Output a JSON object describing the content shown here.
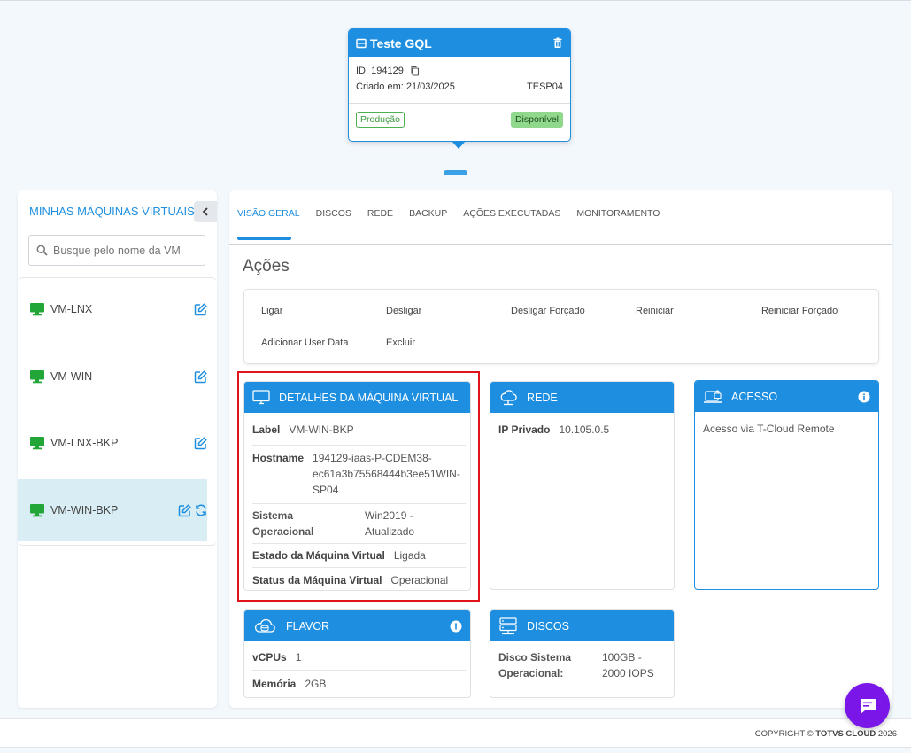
{
  "project": {
    "title": "Teste GQL",
    "id_label": "ID: 194129",
    "created": "Criado em: 21/03/2025",
    "code": "TESP04",
    "env_tag": "Produção",
    "status_tag": "Disponível"
  },
  "sidebar": {
    "title": "MINHAS MÁQUINAS VIRTUAIS",
    "search_placeholder": "Busque pelo nome da VM",
    "vms": [
      {
        "name": "VM-LNX"
      },
      {
        "name": "VM-WIN"
      },
      {
        "name": "VM-LNX-BKP"
      },
      {
        "name": "VM-WIN-BKP",
        "selected": true
      }
    ]
  },
  "tabs": [
    "VISÃO GERAL",
    "DISCOS",
    "REDE",
    "BACKUP",
    "AÇÕES EXECUTADAS",
    "MONITORAMENTO"
  ],
  "actions": {
    "title": "Ações",
    "items": [
      "Ligar",
      "Desligar",
      "Desligar Forçado",
      "Reiniciar",
      "Reiniciar Forçado",
      "Adicionar User Data",
      "Excluir"
    ]
  },
  "details": {
    "title": "DETALHES DA MÁQUINA VIRTUAL",
    "label_k": "Label",
    "label_v": "VM-WIN-BKP",
    "hostname_k": "Hostname",
    "hostname_v1": "194129-iaas-P-CDEM38-",
    "hostname_v2": "ec61a3b75568444b3ee51WIN-",
    "hostname_v3": "SP04",
    "so_k1": "Sistema",
    "so_k2": "Operacional",
    "so_v1": "Win2019 -",
    "so_v2": "Atualizado",
    "estado_k": "Estado da Máquina Virtual",
    "estado_v": "Ligada",
    "status_k": "Status da Máquina Virtual",
    "status_v": "Operacional"
  },
  "rede": {
    "title": "REDE",
    "ip_k": "IP Privado",
    "ip_v": "10.105.0.5"
  },
  "acesso": {
    "title": "ACESSO",
    "text": "Acesso via T-Cloud Remote"
  },
  "flavor": {
    "title": "FLAVOR",
    "vcpu_k": "vCPUs",
    "vcpu_v": "1",
    "mem_k": "Memória",
    "mem_v": "2GB"
  },
  "discos": {
    "title": "DISCOS",
    "k1": "Disco Sistema",
    "k2": "Operacional:",
    "v1": "100GB -",
    "v2": "2000 IOPS"
  },
  "footer": {
    "copy_prefix": "COPYRIGHT ©",
    "copy_brand": "TOTVS CLOUD",
    "copy_year": "2026"
  },
  "colors": {
    "primary": "#1e8fe0",
    "vm_icon": "#21a637",
    "chat": "#7a16e8",
    "highlight": "#e0141b"
  }
}
